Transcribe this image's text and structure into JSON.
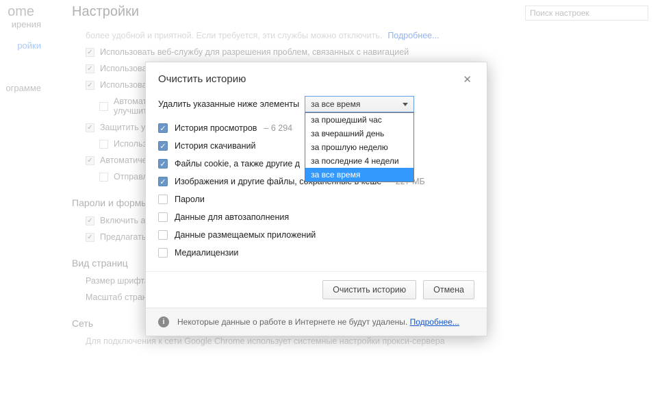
{
  "app": {
    "brand_fragment": "ome"
  },
  "sidebar": {
    "items": [
      {
        "label": "ирения"
      },
      {
        "label": "ройки",
        "selected": true
      },
      {
        "label": ""
      },
      {
        "label": "ограмме"
      }
    ]
  },
  "page": {
    "title": "Настройки",
    "search_placeholder": "Поиск настроек"
  },
  "bg_settings": {
    "learn_more": "Подробнее...",
    "rows": [
      {
        "checked": true,
        "label": "Использовать веб-службу для разрешения проблем, связанных с навигацией"
      },
      {
        "checked": true,
        "label": "Использоват"
      },
      {
        "checked": true,
        "label": "Использоват"
      },
      {
        "checked": false,
        "label": "Автоматиче",
        "sublabel": "улучшить ра",
        "indent": true
      },
      {
        "checked": true,
        "label": "Защитить ус"
      },
      {
        "checked": false,
        "label": "Использоват",
        "indent": true
      },
      {
        "checked": true,
        "label": "Автоматиче"
      },
      {
        "checked": false,
        "label": "Отправлять",
        "indent": true
      }
    ],
    "section_passwords": "Пароли и формы",
    "pw_rows": [
      {
        "checked": true,
        "label": "Включить ав"
      },
      {
        "checked": true,
        "label": "Предлагать"
      }
    ],
    "section_view": "Вид страниц",
    "view_rows": [
      {
        "label": "Размер шрифта"
      },
      {
        "label": "Масштаб страни"
      }
    ],
    "section_net": "Сеть",
    "net_text": "Для подключения к сети Google Chrome использует системные настройки прокси-сервера"
  },
  "modal": {
    "title": "Очистить историю",
    "delete_label": "Удалить указанные ниже элементы",
    "select_value": "за все время",
    "dropdown": {
      "options": [
        "за прошедший час",
        "за вчерашний день",
        "за прошлую неделю",
        "за последние 4 недели",
        "за все время"
      ],
      "selected_index": 4
    },
    "options": [
      {
        "checked": true,
        "label": "История просмотров",
        "suffix": "– 6 294"
      },
      {
        "checked": true,
        "label": "История скачиваний"
      },
      {
        "checked": true,
        "label": "Файлы cookie, а также другие д"
      },
      {
        "checked": true,
        "label": "Изображения и другие файлы, сохраненные в кеше",
        "suffix": "– 227 МБ"
      },
      {
        "checked": false,
        "label": "Пароли"
      },
      {
        "checked": false,
        "label": "Данные для автозаполнения"
      },
      {
        "checked": false,
        "label": "Данные размещаемых приложений"
      },
      {
        "checked": false,
        "label": "Медиалицензии"
      }
    ],
    "buttons": {
      "primary": "Очистить историю",
      "cancel": "Отмена"
    },
    "info_text": "Некоторые данные о работе в Интернете не будут удалены.",
    "info_link": "Подробнее..."
  }
}
